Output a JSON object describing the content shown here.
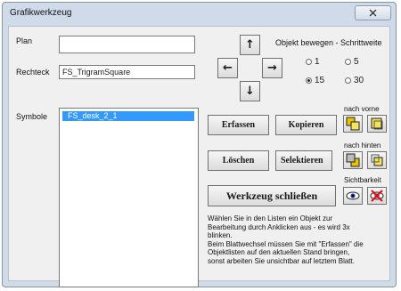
{
  "window": {
    "title": "Grafikwerkzeug",
    "close_glyph": "X"
  },
  "fields": {
    "plan_label": "Plan",
    "plan_value": "",
    "rechteck_label": "Rechteck",
    "rechteck_value": "FS_TrigramSquare",
    "symbole_label": "Symbole",
    "symbole_items": [
      "FS_desk_2_1"
    ]
  },
  "move": {
    "heading": "Objekt bewegen - Schrittweite",
    "up": "↑",
    "left": "←",
    "right": "→",
    "down": "↓",
    "steps": [
      {
        "label": "1",
        "selected": false
      },
      {
        "label": "5",
        "selected": false
      },
      {
        "label": "15",
        "selected": true
      },
      {
        "label": "30",
        "selected": false
      }
    ]
  },
  "buttons": {
    "erfassen": "Erfassen",
    "kopieren": "Kopieren",
    "loeschen": "Löschen",
    "selektieren": "Selektieren",
    "schliessen": "Werkzeug schließen"
  },
  "layers": {
    "nach_vorne": "nach vorne",
    "nach_hinten": "nach hinten",
    "sichtbarkeit": "Sichtbarkeit"
  },
  "help_lines": [
    "Wählen Sie in den Listen ein Objekt zur",
    "Bearbeitung durch Anklicken aus - es wird 3x",
    "blinken.",
    "Beim Blattwechsel müssen Sie mit \"Erfassen\" die",
    "Objektlisten auf den aktuellen Stand bringen,",
    "sonst arbeiten Sie unsichtbar auf letztem Blatt."
  ],
  "colors": {
    "selection": "#3399ff",
    "frame": "#cfdbe9",
    "face": "#f0f0f0"
  }
}
